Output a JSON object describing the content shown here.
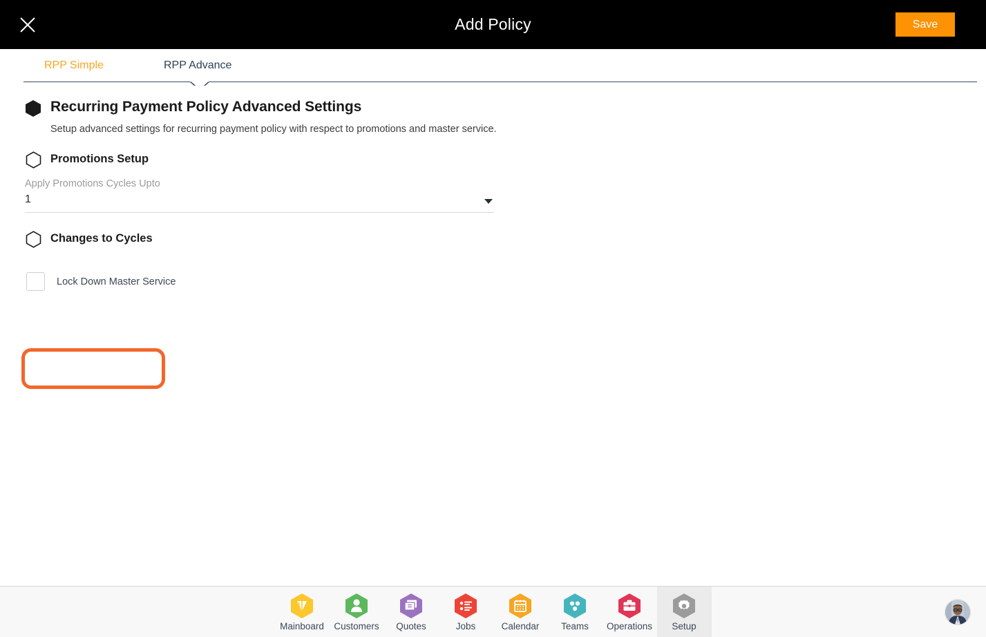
{
  "header": {
    "title": "Add Policy",
    "close_icon": "close-icon",
    "save_label": "Save",
    "background_color": "#000000",
    "save_color": "#fd9204"
  },
  "tabs": [
    {
      "label": "RPP Simple",
      "active": false,
      "color": "#f5a623"
    },
    {
      "label": "RPP Advance",
      "active": true,
      "color": "#2e4057"
    }
  ],
  "main": {
    "page_title": "Recurring Payment Policy Advanced Settings",
    "page_subtitle": "Setup advanced settings for recurring payment policy with respect to promotions and master service.",
    "title_icon": "hexagon-filled-icon",
    "sections": [
      {
        "label": "Promotions Setup",
        "icon": "hexagon-outline-icon",
        "field": {
          "label": "Apply Promotions Cycles Upto",
          "value": "1",
          "dropdown_icon": "chevron-down-icon"
        }
      },
      {
        "label": "Changes to Cycles",
        "icon": "hexagon-outline-icon",
        "checkbox": {
          "label": "Lock Down Master Service",
          "checked": false
        }
      }
    ],
    "annotation_color": "#f2672a"
  },
  "bottom_nav": {
    "items": [
      {
        "label": "Mainboard",
        "icon": "mainboard-icon",
        "color": "#fcc62d",
        "active": false
      },
      {
        "label": "Customers",
        "icon": "customers-icon",
        "color": "#5cb85c",
        "active": false
      },
      {
        "label": "Quotes",
        "icon": "quotes-icon",
        "color": "#9b72c0",
        "active": false
      },
      {
        "label": "Jobs",
        "icon": "jobs-icon",
        "color": "#ed4436",
        "active": false
      },
      {
        "label": "Calendar",
        "icon": "calendar-icon",
        "color": "#f5a623",
        "active": false
      },
      {
        "label": "Teams",
        "icon": "teams-icon",
        "color": "#45b5bd",
        "active": false
      },
      {
        "label": "Operations",
        "icon": "operations-icon",
        "color": "#e13457",
        "active": false
      },
      {
        "label": "Setup",
        "icon": "gear-icon",
        "color": "#9b9b9b",
        "active": true
      }
    ],
    "avatar": "user-avatar"
  }
}
